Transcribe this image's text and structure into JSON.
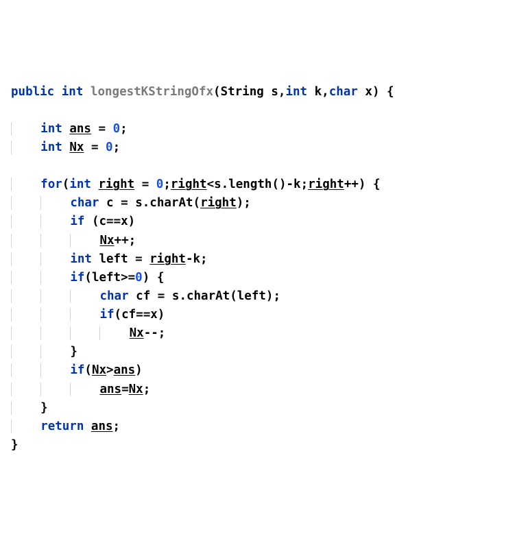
{
  "code": {
    "lines": [
      {
        "indent": 0,
        "tokens": [
          [
            "kw",
            "public"
          ],
          [
            "sp",
            " "
          ],
          [
            "kw",
            "int"
          ],
          [
            "sp",
            " "
          ],
          [
            "fn",
            "longestKStringOfx"
          ],
          [
            "pun",
            "("
          ],
          [
            "id",
            "String s"
          ],
          [
            "pun",
            ","
          ],
          [
            "kw",
            "int"
          ],
          [
            "sp",
            " "
          ],
          [
            "id",
            "k"
          ],
          [
            "pun",
            ","
          ],
          [
            "kw",
            "char"
          ],
          [
            "sp",
            " "
          ],
          [
            "id",
            "x"
          ],
          [
            "pun",
            ")"
          ],
          [
            "sp",
            " "
          ],
          [
            "pun",
            "{"
          ]
        ]
      },
      {
        "indent": 0,
        "tokens": []
      },
      {
        "indent": 1,
        "tokens": [
          [
            "kw",
            "int"
          ],
          [
            "sp",
            " "
          ],
          [
            "und",
            "ans"
          ],
          [
            "sp",
            " "
          ],
          [
            "pun",
            "="
          ],
          [
            "sp",
            " "
          ],
          [
            "num",
            "0"
          ],
          [
            "pun",
            ";"
          ]
        ]
      },
      {
        "indent": 1,
        "tokens": [
          [
            "kw",
            "int"
          ],
          [
            "sp",
            " "
          ],
          [
            "und",
            "Nx"
          ],
          [
            "sp",
            " "
          ],
          [
            "pun",
            "="
          ],
          [
            "sp",
            " "
          ],
          [
            "num",
            "0"
          ],
          [
            "pun",
            ";"
          ]
        ]
      },
      {
        "indent": 0,
        "tokens": []
      },
      {
        "indent": 1,
        "tokens": [
          [
            "kw",
            "for"
          ],
          [
            "pun",
            "("
          ],
          [
            "kw",
            "int"
          ],
          [
            "sp",
            " "
          ],
          [
            "und",
            "right"
          ],
          [
            "sp",
            " "
          ],
          [
            "pun",
            "="
          ],
          [
            "sp",
            " "
          ],
          [
            "num",
            "0"
          ],
          [
            "pun",
            ";"
          ],
          [
            "und",
            "right"
          ],
          [
            "pun",
            "<"
          ],
          [
            "id",
            "s"
          ],
          [
            "pun",
            "."
          ],
          [
            "id",
            "length"
          ],
          [
            "pun",
            "()-"
          ],
          [
            "id",
            "k"
          ],
          [
            "pun",
            ";"
          ],
          [
            "und",
            "right"
          ],
          [
            "pun",
            "++)"
          ],
          [
            "sp",
            " "
          ],
          [
            "pun",
            "{"
          ]
        ]
      },
      {
        "indent": 2,
        "tokens": [
          [
            "kw",
            "char"
          ],
          [
            "sp",
            " "
          ],
          [
            "id",
            "c"
          ],
          [
            "sp",
            " "
          ],
          [
            "pun",
            "="
          ],
          [
            "sp",
            " "
          ],
          [
            "id",
            "s"
          ],
          [
            "pun",
            "."
          ],
          [
            "id",
            "charAt"
          ],
          [
            "pun",
            "("
          ],
          [
            "und",
            "right"
          ],
          [
            "pun",
            ")"
          ],
          [
            "pun",
            ";"
          ]
        ]
      },
      {
        "indent": 2,
        "tokens": [
          [
            "kw",
            "if"
          ],
          [
            "sp",
            " "
          ],
          [
            "pun",
            "("
          ],
          [
            "id",
            "c"
          ],
          [
            "pun",
            "=="
          ],
          [
            "id",
            "x"
          ],
          [
            "pun",
            ")"
          ]
        ]
      },
      {
        "indent": 3,
        "tokens": [
          [
            "und",
            "Nx"
          ],
          [
            "pun",
            "++;"
          ]
        ]
      },
      {
        "indent": 2,
        "tokens": [
          [
            "kw",
            "int"
          ],
          [
            "sp",
            " "
          ],
          [
            "id",
            "left"
          ],
          [
            "sp",
            " "
          ],
          [
            "pun",
            "="
          ],
          [
            "sp",
            " "
          ],
          [
            "und",
            "right"
          ],
          [
            "pun",
            "-"
          ],
          [
            "id",
            "k"
          ],
          [
            "pun",
            ";"
          ]
        ]
      },
      {
        "indent": 2,
        "tokens": [
          [
            "kw",
            "if"
          ],
          [
            "pun",
            "("
          ],
          [
            "id",
            "left"
          ],
          [
            "pun",
            ">="
          ],
          [
            "num",
            "0"
          ],
          [
            "pun",
            ")"
          ],
          [
            "sp",
            " "
          ],
          [
            "pun",
            "{"
          ]
        ]
      },
      {
        "indent": 3,
        "tokens": [
          [
            "kw",
            "char"
          ],
          [
            "sp",
            " "
          ],
          [
            "id",
            "cf"
          ],
          [
            "sp",
            " "
          ],
          [
            "pun",
            "="
          ],
          [
            "sp",
            " "
          ],
          [
            "id",
            "s"
          ],
          [
            "pun",
            "."
          ],
          [
            "id",
            "charAt"
          ],
          [
            "pun",
            "("
          ],
          [
            "id",
            "left"
          ],
          [
            "pun",
            ")"
          ],
          [
            "pun",
            ";"
          ]
        ]
      },
      {
        "indent": 3,
        "tokens": [
          [
            "kw",
            "if"
          ],
          [
            "pun",
            "("
          ],
          [
            "id",
            "cf"
          ],
          [
            "pun",
            "=="
          ],
          [
            "id",
            "x"
          ],
          [
            "pun",
            ")"
          ]
        ]
      },
      {
        "indent": 4,
        "tokens": [
          [
            "und",
            "Nx"
          ],
          [
            "pun",
            "--;"
          ]
        ]
      },
      {
        "indent": 2,
        "tokens": [
          [
            "pun",
            "}"
          ]
        ]
      },
      {
        "indent": 2,
        "tokens": [
          [
            "kw",
            "if"
          ],
          [
            "pun",
            "("
          ],
          [
            "und",
            "Nx"
          ],
          [
            "pun",
            ">"
          ],
          [
            "und",
            "ans"
          ],
          [
            "pun",
            ")"
          ]
        ]
      },
      {
        "indent": 3,
        "tokens": [
          [
            "und",
            "ans"
          ],
          [
            "pun",
            "="
          ],
          [
            "und",
            "Nx"
          ],
          [
            "pun",
            ";"
          ]
        ]
      },
      {
        "indent": 1,
        "tokens": [
          [
            "pun",
            "}"
          ]
        ]
      },
      {
        "indent": 1,
        "tokens": [
          [
            "kw",
            "return"
          ],
          [
            "sp",
            " "
          ],
          [
            "und",
            "ans"
          ],
          [
            "pun",
            ";"
          ]
        ]
      },
      {
        "indent": 0,
        "tokens": [
          [
            "pun",
            "}"
          ]
        ]
      }
    ],
    "indent_unit": "    "
  }
}
